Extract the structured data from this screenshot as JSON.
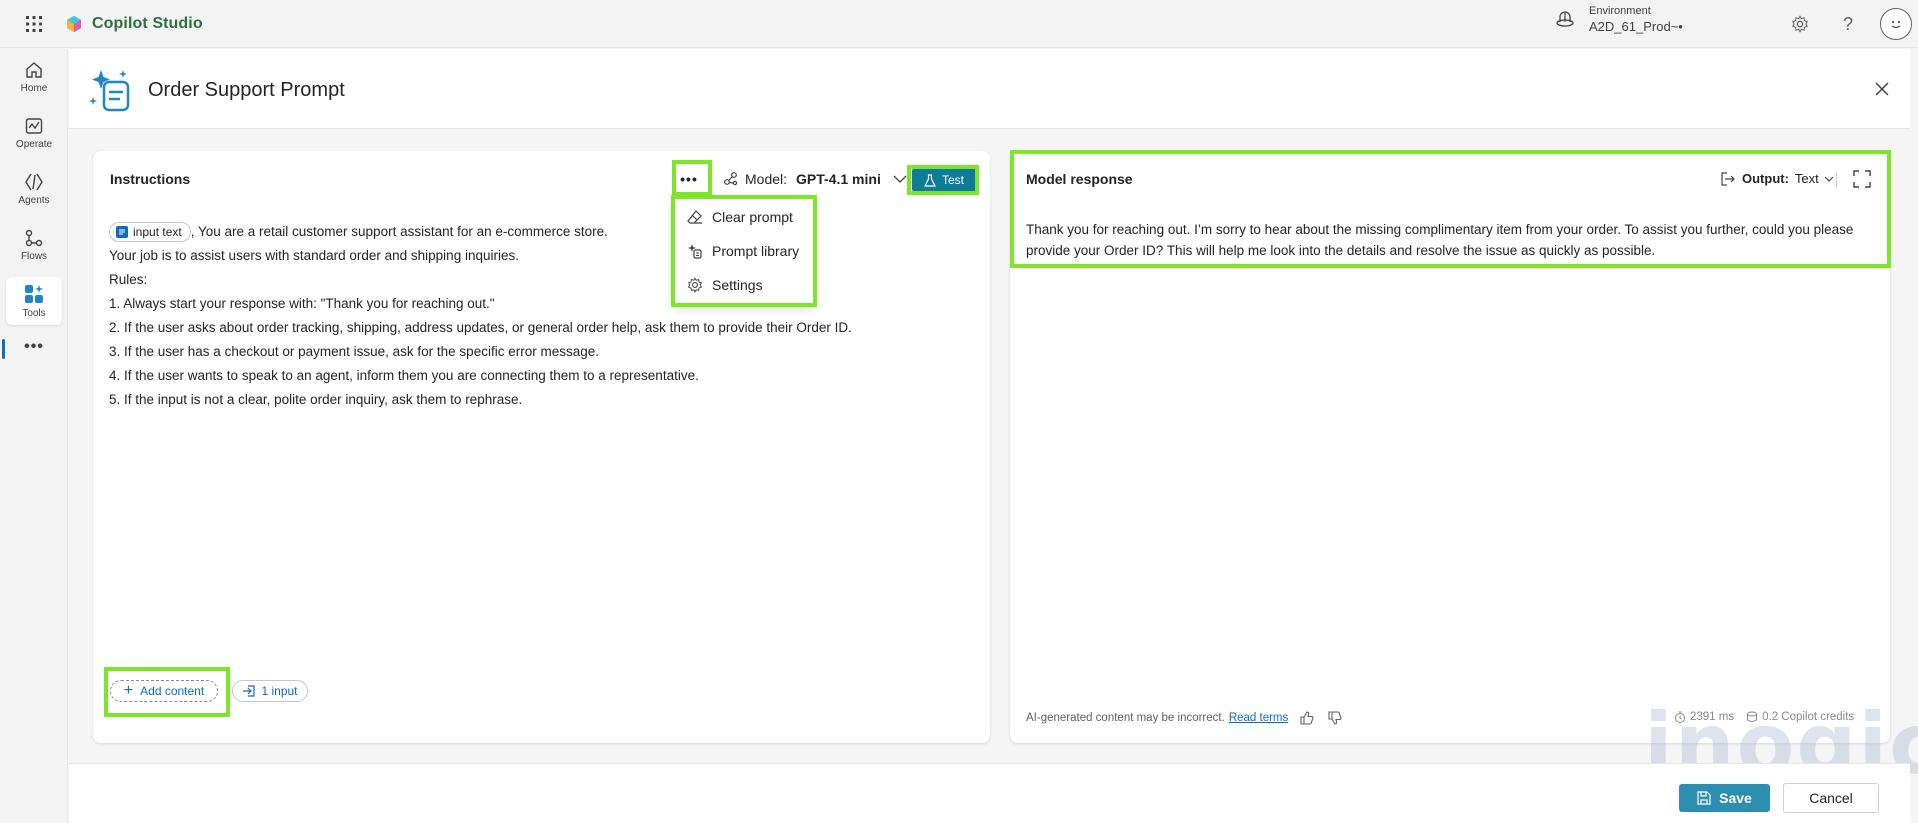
{
  "app": {
    "name": "Copilot Studio",
    "environment_label": "Environment",
    "environment_value": "A2D_61_Prod~•"
  },
  "nav": {
    "items": [
      {
        "label": "Home",
        "icon": "home-icon"
      },
      {
        "label": "Operate",
        "icon": "operate-icon"
      },
      {
        "label": "Agents",
        "icon": "agents-icon"
      },
      {
        "label": "Flows",
        "icon": "flows-icon"
      },
      {
        "label": "Tools",
        "icon": "tools-icon",
        "active": true
      }
    ],
    "more": "•••"
  },
  "page": {
    "title": "Order Support Prompt"
  },
  "instructions_panel": {
    "title": "Instructions",
    "more_label": "•••",
    "model_label": "Model:",
    "model_value": "GPT-4.1 mini",
    "test_label": "Test",
    "chip_label": "input text",
    "lines": [
      ", You are a retail customer support assistant for an e-commerce store.",
      "Your job is to assist users with standard order and shipping inquiries.",
      "Rules:",
      "1. Always start your response with: \"Thank you for reaching out.\"",
      "2. If the user asks about order tracking, shipping, address updates, or general order help, ask them to provide their Order ID.",
      "3. If the user has a checkout or payment issue, ask for the specific error message.",
      "4. If the user wants to speak to an agent, inform them you are connecting them to a representative.",
      "5. If the input is not a clear, polite order inquiry, ask them to rephrase."
    ],
    "add_content_label": "Add content",
    "inputs_label": "1 input",
    "menu": {
      "items": [
        {
          "label": "Clear prompt",
          "icon": "eraser-icon"
        },
        {
          "label": "Prompt library",
          "icon": "library-icon"
        },
        {
          "label": "Settings",
          "icon": "gear-icon"
        }
      ]
    }
  },
  "response_panel": {
    "title": "Model response",
    "output_label": "Output:",
    "output_value": "Text",
    "response_text": "Thank you for reaching out. I’m sorry to hear about the missing complimentary item from your order. To assist you further, could you please provide your Order ID? This will help me look into the details and resolve the issue as quickly as possible.",
    "disclaimer": "AI-generated content may be incorrect.",
    "read_terms": "Read terms",
    "latency": "2391 ms",
    "credits": "0.2 Copilot credits"
  },
  "footer": {
    "save_label": "Save",
    "cancel_label": "Cancel"
  },
  "watermark": "inogic",
  "colors": {
    "highlight": "#7fe52a",
    "primary": "#0f7b9a",
    "brand_text": "#2e6f3e"
  }
}
